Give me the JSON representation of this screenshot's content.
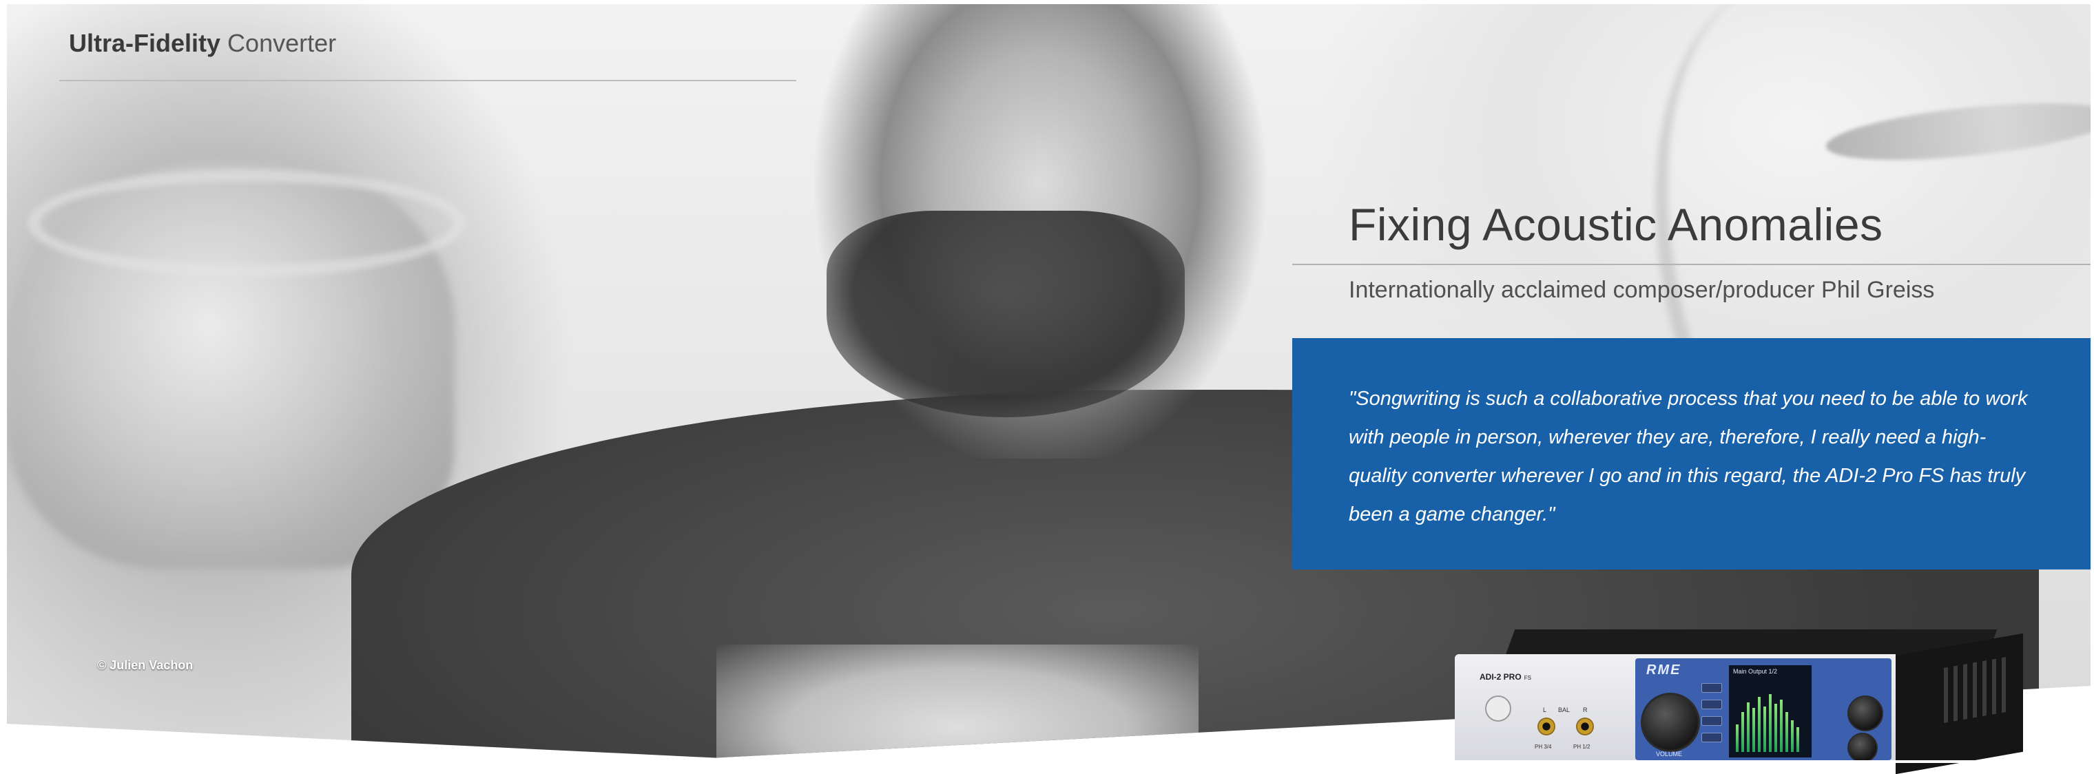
{
  "header": {
    "title_strong": "Ultra-Fidelity",
    "title_light": "Converter"
  },
  "feature": {
    "title": "Fixing Acoustic Anomalies",
    "subtitle": "Internationally acclaimed composer/producer Phil Greiss",
    "quote": "\"Songwriting is such a collaborative process that you need to be able to work with people in person, wherever they are, therefore, I really need a high-quality converter wherever I go and in this regard, the ADI-2 Pro FS has truly been a game changer.\""
  },
  "photo": {
    "credit": "© Julien Vachon"
  },
  "device": {
    "model": "ADI-2 PRO",
    "model_suffix": "FS",
    "brand": "RME",
    "jack_left_label": "L",
    "jack_bal_label": "BAL",
    "jack_right_label": "R",
    "phones_left_label": "PH 3/4",
    "phones_right_label": "PH 1/2",
    "volume_label": "VOLUME",
    "screen_title": "Main Output 1/2"
  },
  "colors": {
    "quote_background": "#1860a8",
    "rule": "#bdbdbd"
  }
}
